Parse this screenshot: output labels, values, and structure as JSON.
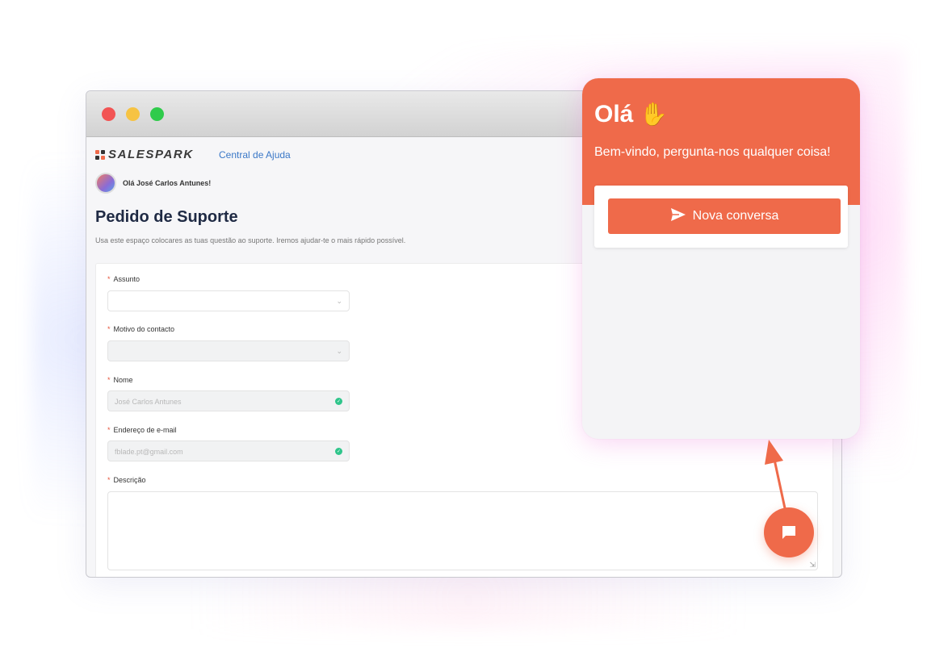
{
  "brand": {
    "logo_text": "SALESPARK",
    "help_link": "Central de Ajuda"
  },
  "user": {
    "greeting": "Olá José Carlos Antunes!"
  },
  "page": {
    "title": "Pedido de Suporte",
    "subtitle": "Usa este espaço colocares as tuas questão ao suporte. Iremos ajudar-te o mais rápido possível."
  },
  "form": {
    "required_mark": "*",
    "subject_label": "Assunto",
    "subject_value": "",
    "reason_label": "Motivo do contacto",
    "reason_value": "",
    "name_label": "Nome",
    "name_value": "José Carlos Antunes",
    "email_label": "Endereço de e-mail",
    "email_value": "fblade.pt@gmail.com",
    "description_label": "Descrição",
    "description_value": ""
  },
  "widget": {
    "title": "Olá",
    "wave_icon": "waving-hand-icon",
    "subtitle": "Bem-vindo, pergunta-nos qualquer coisa!",
    "new_conversation_label": "Nova conversa",
    "accent_color": "#ef6a4a"
  },
  "launcher": {
    "icon": "chat-bubble-icon"
  },
  "window_controls": {
    "close_color": "#f25454",
    "minimize_color": "#f6c343",
    "maximize_color": "#2fcb4b"
  }
}
